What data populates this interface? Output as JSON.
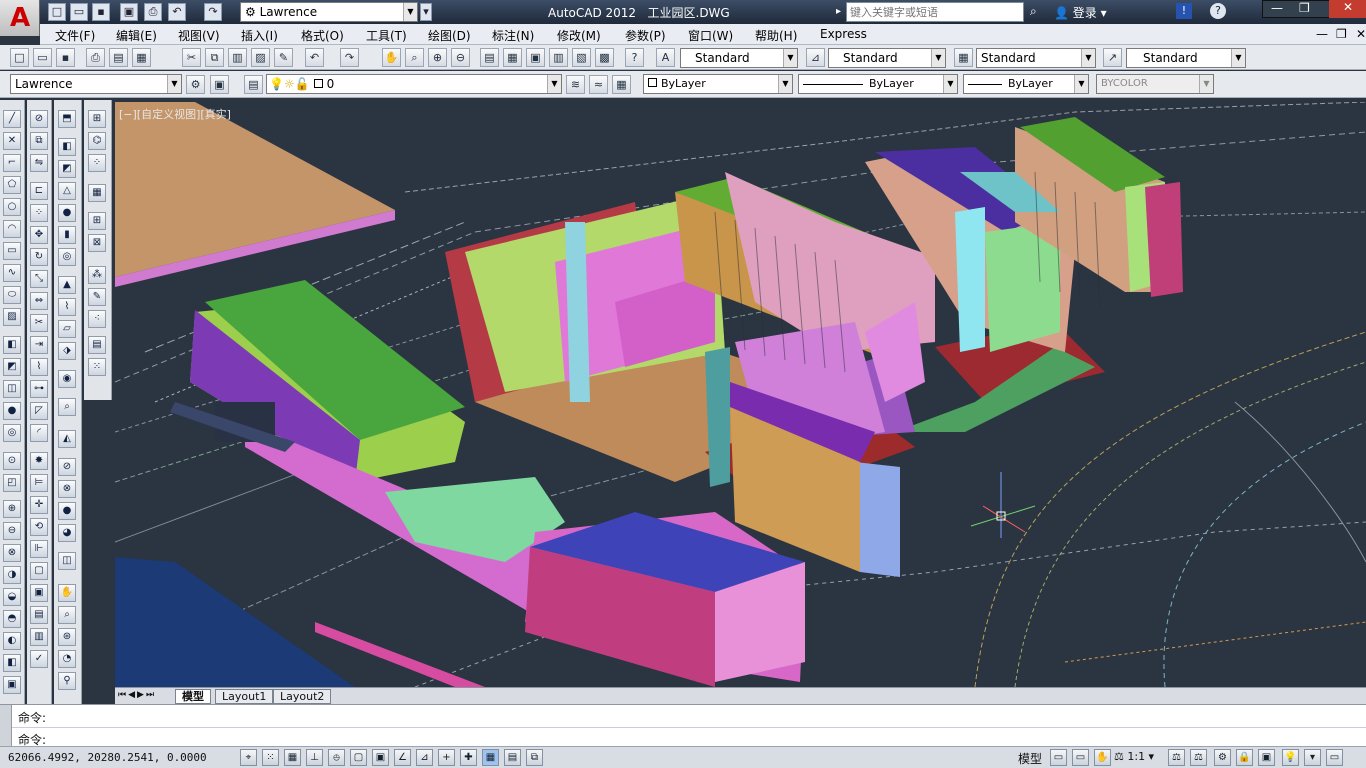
{
  "title": {
    "app": "AutoCAD 2012",
    "file": "工业园区.DWG",
    "workspace": "Lawrence",
    "search_placeholder": "键入关键字或短语",
    "login": "登录"
  },
  "menus": [
    "文件(F)",
    "编辑(E)",
    "视图(V)",
    "插入(I)",
    "格式(O)",
    "工具(T)",
    "绘图(D)",
    "标注(N)",
    "修改(M)",
    "参数(P)",
    "窗口(W)",
    "帮助(H)",
    "Express"
  ],
  "styles": {
    "text": "Standard",
    "dim": "Standard",
    "table": "Standard",
    "mleader": "Standard"
  },
  "layers": {
    "workspace": "Lawrence",
    "current_layer": "0"
  },
  "props": {
    "color": "ByLayer",
    "linetype": "ByLayer",
    "lineweight": "ByLayer",
    "plotstyle": "BYCOLOR"
  },
  "viewport": {
    "label": "[−][自定义视图][真实]"
  },
  "tabs": {
    "model": "模型",
    "layout1": "Layout1",
    "layout2": "Layout2"
  },
  "command": {
    "history": "命令:",
    "prompt": "命令:"
  },
  "status": {
    "coords": "62066.4992, 20280.2541, 0.0000",
    "model": "模型",
    "scale": "1:1"
  },
  "colors": {
    "accent": "#3c4d66",
    "viewport_bg": "#2b3441"
  }
}
